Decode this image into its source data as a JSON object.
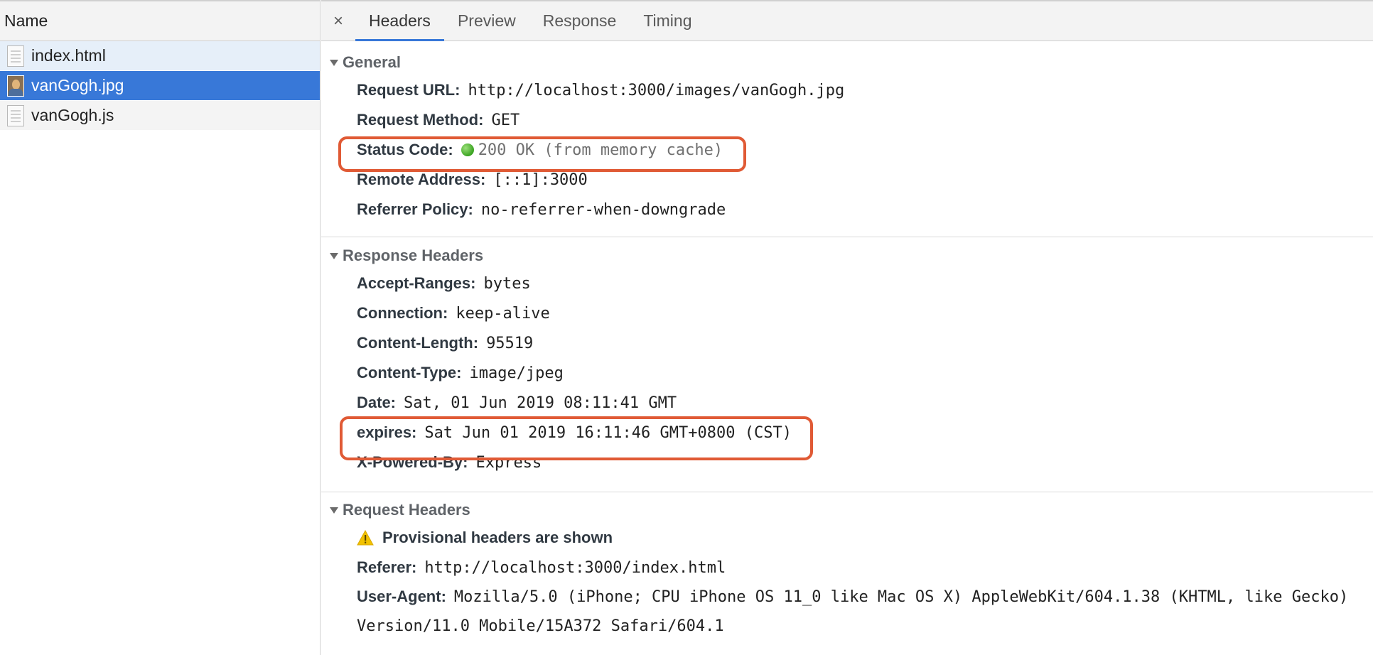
{
  "sidebar": {
    "header": "Name",
    "files": [
      {
        "name": "index.html",
        "icon": "document-icon"
      },
      {
        "name": "vanGogh.jpg",
        "icon": "image-icon"
      },
      {
        "name": "vanGogh.js",
        "icon": "document-icon"
      }
    ]
  },
  "tabs": {
    "close": "×",
    "items": [
      "Headers",
      "Preview",
      "Response",
      "Timing"
    ],
    "active": "Headers"
  },
  "general": {
    "title": "General",
    "rows": [
      {
        "key": "Request URL:",
        "value": "http://localhost:3000/images/vanGogh.jpg"
      },
      {
        "key": "Request Method:",
        "value": "GET"
      },
      {
        "key": "Status Code:",
        "value": "200 OK (from memory cache)"
      },
      {
        "key": "Remote Address:",
        "value": "[::1]:3000"
      },
      {
        "key": "Referrer Policy:",
        "value": "no-referrer-when-downgrade"
      }
    ]
  },
  "response_headers": {
    "title": "Response Headers",
    "rows": [
      {
        "key": "Accept-Ranges:",
        "value": "bytes"
      },
      {
        "key": "Connection:",
        "value": "keep-alive"
      },
      {
        "key": "Content-Length:",
        "value": "95519"
      },
      {
        "key": "Content-Type:",
        "value": "image/jpeg"
      },
      {
        "key": "Date:",
        "value": "Sat, 01 Jun 2019 08:11:41 GMT"
      },
      {
        "key": "expires:",
        "value": "Sat Jun 01 2019 16:11:46 GMT+0800 (CST)"
      },
      {
        "key": "X-Powered-By:",
        "value": "Express"
      }
    ]
  },
  "request_headers": {
    "title": "Request Headers",
    "warning": "Provisional headers are shown",
    "rows": [
      {
        "key": "Referer:",
        "value": "http://localhost:3000/index.html"
      },
      {
        "key": "User-Agent:",
        "value": "Mozilla/5.0 (iPhone; CPU iPhone OS 11_0 like Mac OS X) AppleWebKit/604.1.38 (KHTML, like Gecko) Version/11.0 Mobile/15A372 Safari/604.1"
      }
    ]
  },
  "colors": {
    "selection": "#3878d8",
    "highlight_box": "#e05a35",
    "status_ok": "#3aa321"
  }
}
